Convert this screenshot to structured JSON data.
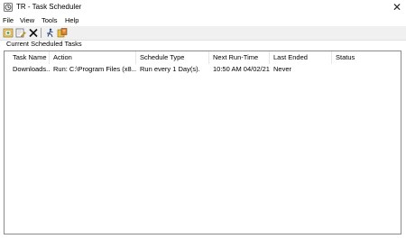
{
  "window": {
    "title": "TR - Task Scheduler",
    "close_glyph": "✕"
  },
  "menu": [
    "File",
    "View",
    "Tools",
    "Help"
  ],
  "toolbar": {
    "buttons": [
      "add-task-icon",
      "edit-task-icon",
      "delete-icon",
      "run-task-icon",
      "scheduler-icon"
    ]
  },
  "section": {
    "label": "Current Scheduled Tasks"
  },
  "table": {
    "columns": [
      "Task Name",
      "Action",
      "Schedule Type",
      "Next Run-Time",
      "Last Ended",
      "Status"
    ],
    "rows": [
      [
        "Downloads...",
        "Run: C:\\Program Files (x8...",
        "Run every 1 Day(s).",
        "10:50 AM 04/02/21",
        "Never",
        ""
      ]
    ]
  },
  "colors": {
    "icon_gold": "#d9a42b",
    "icon_orange": "#e07a1f",
    "icon_blue": "#3a6fb8"
  }
}
